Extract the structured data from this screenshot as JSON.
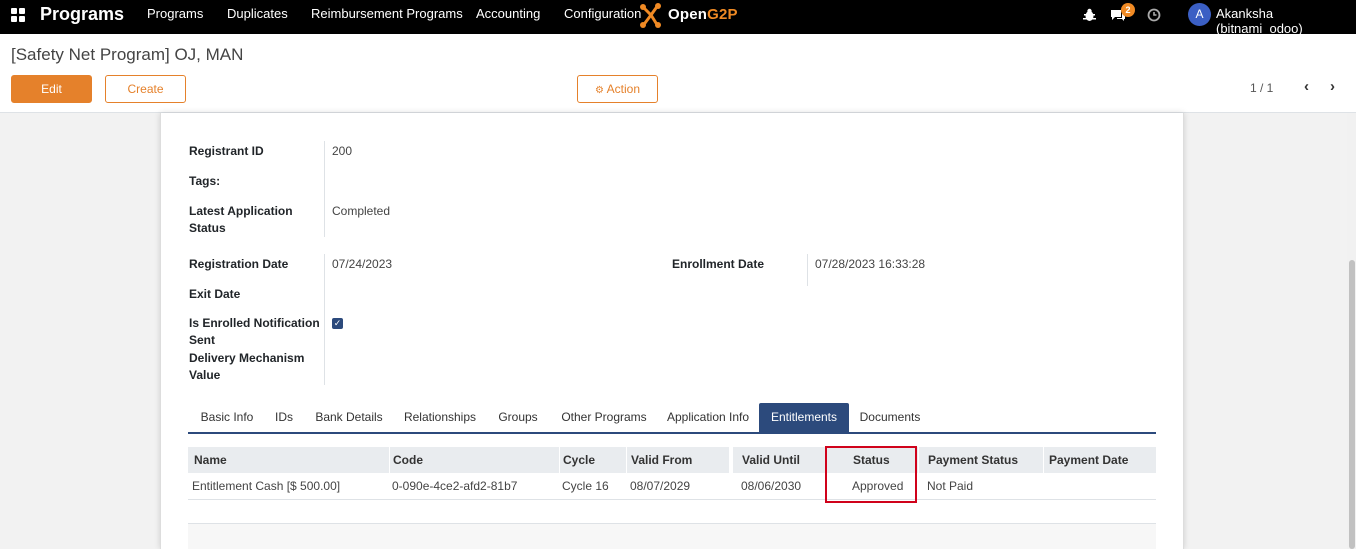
{
  "topbar": {
    "app_title": "Programs",
    "menu": [
      "Programs",
      "Duplicates",
      "Reimbursement Programs",
      "Accounting",
      "Configuration"
    ],
    "logo_text": "OpenG2P",
    "logo_part1": "Open",
    "logo_part2": "G2P",
    "messages_count": "2",
    "user_initial": "A",
    "user_name": "Akanksha (bitnami_odoo)"
  },
  "control_panel": {
    "breadcrumb": "[Safety Net Program] OJ, MAN",
    "edit_label": "Edit",
    "create_label": "Create",
    "action_label": "Action",
    "pager": "1 / 1"
  },
  "form": {
    "registrant_id_label": "Registrant ID",
    "registrant_id": "200",
    "tags_label": "Tags:",
    "latest_app_status_label_1": "Latest Application",
    "latest_app_status_label_2": "Status",
    "latest_app_status": "Completed",
    "registration_date_label": "Registration Date",
    "registration_date": "07/24/2023",
    "enrollment_date_label": "Enrollment Date",
    "enrollment_date": "07/28/2023 16:33:28",
    "exit_date_label": "Exit Date",
    "enrolled_notif_label_1": "Is Enrolled Notification",
    "enrolled_notif_label_2": "Sent",
    "enrolled_notif_checked": true,
    "delivery_label_1": "Delivery Mechanism",
    "delivery_label_2": "Value"
  },
  "tabs": [
    {
      "label": "Basic Info",
      "active": false
    },
    {
      "label": "IDs",
      "active": false
    },
    {
      "label": "Bank Details",
      "active": false
    },
    {
      "label": "Relationships",
      "active": false
    },
    {
      "label": "Groups",
      "active": false
    },
    {
      "label": "Other Programs",
      "active": false
    },
    {
      "label": "Application Info",
      "active": false
    },
    {
      "label": "Entitlements",
      "active": true
    },
    {
      "label": "Documents",
      "active": false
    }
  ],
  "entitlements_table": {
    "columns": [
      "Name",
      "Code",
      "Cycle",
      "Valid From",
      "Valid Until",
      "Status",
      "Payment Status",
      "Payment Date"
    ],
    "rows": [
      {
        "name": "Entitlement Cash [$ 500.00]",
        "code": "0-090e-4ce2-afd2-81b7",
        "cycle": "Cycle 16",
        "valid_from": "08/07/2029",
        "valid_until": "08/06/2030",
        "status": "Approved",
        "payment_status": "Not Paid",
        "payment_date": ""
      }
    ]
  },
  "colors": {
    "accent": "#e5812b",
    "tab_active": "#2c4a7c",
    "highlight": "#d0021b"
  }
}
